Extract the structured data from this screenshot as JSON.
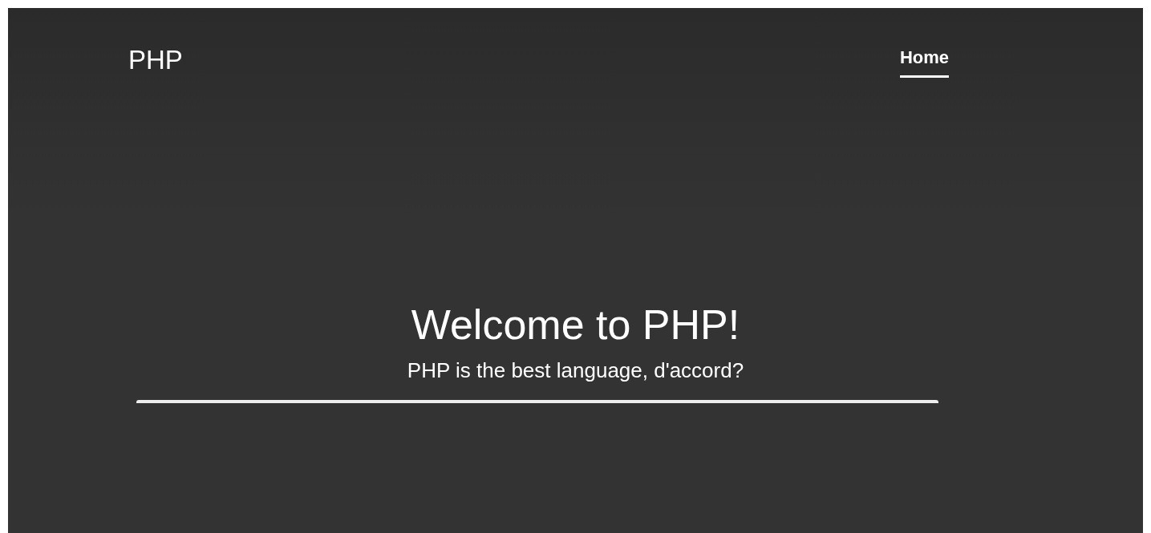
{
  "header": {
    "logo": "PHP",
    "nav": [
      {
        "label": "Home",
        "selected": true
      }
    ]
  },
  "hero": {
    "title": "Welcome to PHP!",
    "subtitle": "PHP is the best language, d'accord?"
  }
}
